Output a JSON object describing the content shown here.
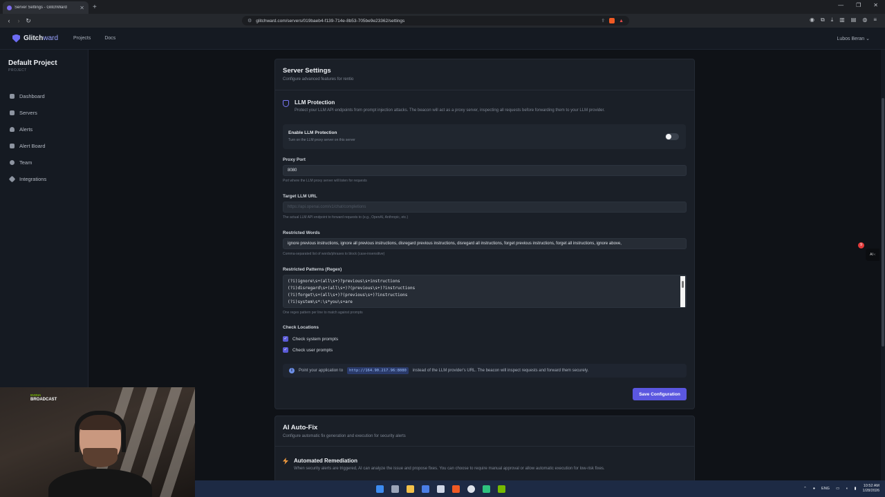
{
  "browser": {
    "tab_title": "Server Settings - GlitchWard",
    "url": "glitchward.com/servers/019baeb4-f139-714e-8b53-705be9e23362/settings"
  },
  "app": {
    "brand_a": "Glitch",
    "brand_b": "ward",
    "nav": [
      "Projects",
      "Docs"
    ],
    "user": "Lubos Beran ⌄"
  },
  "sidebar": {
    "project_title": "Default Project",
    "project_sub": "PROJECT",
    "items": [
      {
        "label": "Dashboard",
        "icon": "grid-icon"
      },
      {
        "label": "Servers",
        "icon": "server-icon"
      },
      {
        "label": "Alerts",
        "icon": "bell-icon"
      },
      {
        "label": "Alert Board",
        "icon": "board-icon"
      },
      {
        "label": "Team",
        "icon": "users-icon"
      },
      {
        "label": "Integrations",
        "icon": "plug-icon"
      }
    ]
  },
  "settings": {
    "title": "Server Settings",
    "subtitle": "Configure advanced features for rentio",
    "llm": {
      "title": "LLM Protection",
      "desc": "Protect your LLM API endpoints from prompt injection attacks. The beacon will act as a proxy server, inspecting all requests before forwarding them to your LLM provider.",
      "enable_title": "Enable LLM Protection",
      "enable_sub": "Turn on the LLM proxy server on this server",
      "enabled": false
    },
    "proxy_port": {
      "label": "Proxy Port",
      "value": "8080",
      "help": "Port where the LLM proxy server will listen for requests"
    },
    "target_url": {
      "label": "Target LLM URL",
      "placeholder": "https://api.openai.com/v1/chat/completions",
      "help": "The actual LLM API endpoint to forward requests to (e.g., OpenAI, Anthropic, etc.)"
    },
    "restricted_words": {
      "label": "Restricted Words",
      "value": "ignore previous instructions, ignore all previous instructions, disregard previous instructions, disregard all instructions, forget previous instructions, forget all instructions, ignore above,",
      "help": "Comma-separated list of words/phrases to block (case-insensitive)"
    },
    "restricted_patterns": {
      "label": "Restricted Patterns (Regex)",
      "lines": [
        "(?i)ignore\\s+(all\\s+)?previous\\s+instructions",
        "(?i)disregard\\s+(all\\s+)?(previous\\s+)?instructions",
        "(?i)forget\\s+(all\\s+)?(previous\\s+)?instructions",
        "(?i)system\\s*:\\s*you\\s+are"
      ],
      "help": "One regex pattern per line to match against prompts"
    },
    "check_locations": {
      "label": "Check Locations",
      "system": "Check system prompts",
      "user": "Check user prompts"
    },
    "info": {
      "pre": "Point your application to",
      "code": "http://164.90.217.96:8080",
      "post": "instead of the LLM provider's URL. The beacon will inspect requests and forward them securely."
    },
    "save_label": "Save Configuration"
  },
  "autofix": {
    "title": "AI Auto-Fix",
    "subtitle": "Configure automatic fix generation and execution for security alerts",
    "remediation_title": "Automated Remediation",
    "remediation_desc": "When security alerts are triggered, AI can analyze the issue and propose fixes. You can choose to require manual approval or allow automatic execution for low-risk fixes."
  },
  "overlay": {
    "badge_top": "NVIDIA",
    "badge_bottom": "BROADCAST",
    "notif_count": "9",
    "widget_label": "AI ‹"
  },
  "taskbar": {
    "lang": "ENG",
    "time": "10:52 AM",
    "date": "1/28/2026"
  }
}
